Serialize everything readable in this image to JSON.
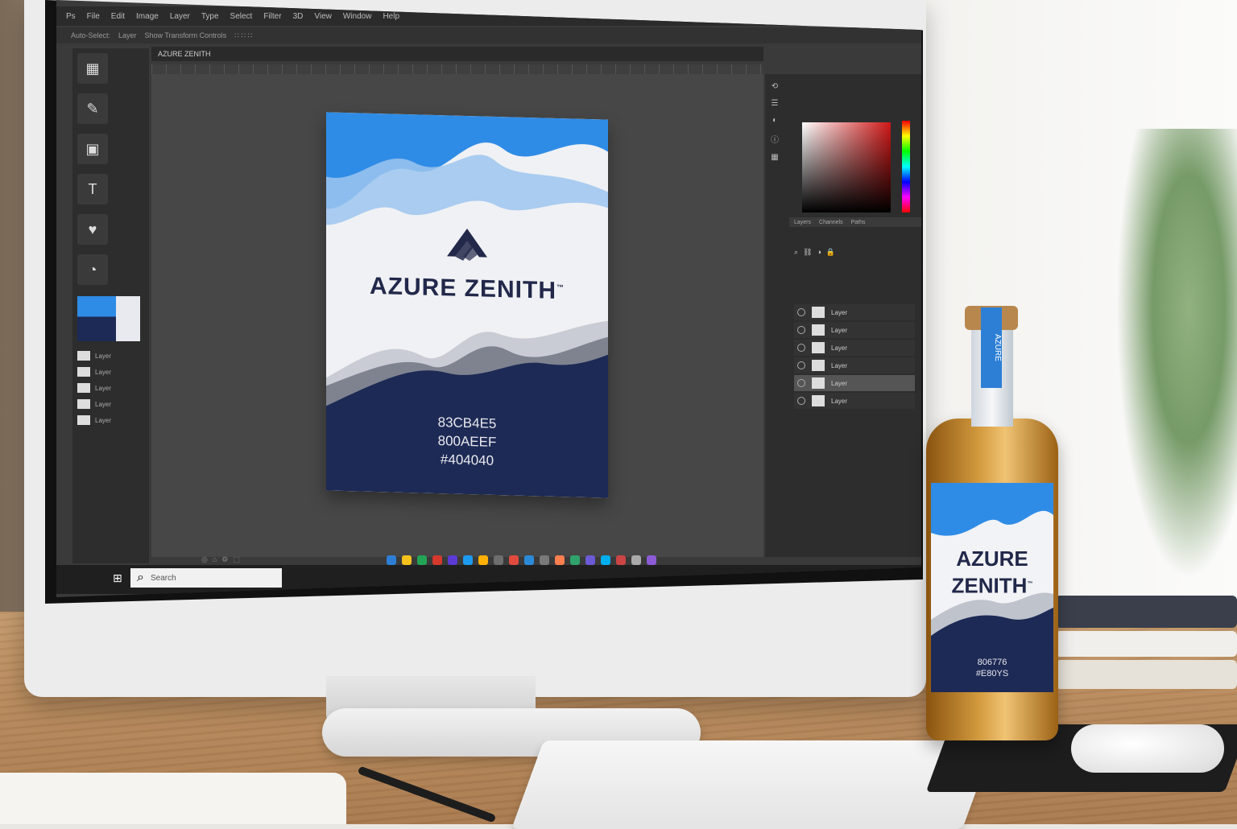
{
  "photoshop": {
    "menu": [
      "Ps",
      "File",
      "Edit",
      "Image",
      "Layer",
      "Type",
      "Select",
      "Filter",
      "3D",
      "View",
      "Window",
      "Help"
    ],
    "options": [
      "Auto-Select:",
      "Layer",
      "Show Transform Controls",
      "∷ ∷ ∷"
    ],
    "document_tab": "AZURE ZENITH",
    "left_tools": [
      {
        "icon": "image-icon",
        "label": ""
      },
      {
        "icon": "brush-icon",
        "label": ""
      },
      {
        "icon": "shape-icon",
        "label": ""
      },
      {
        "icon": "type-icon",
        "label": ""
      },
      {
        "icon": "heart-icon",
        "label": ""
      },
      {
        "icon": "circle-icon",
        "label": ""
      }
    ],
    "left_rows": [
      "Layer",
      "Layer",
      "Layer",
      "Layer",
      "Layer"
    ],
    "layers": [
      {
        "name": "Layer",
        "selected": false
      },
      {
        "name": "Layer",
        "selected": false
      },
      {
        "name": "Layer",
        "selected": false
      },
      {
        "name": "Layer",
        "selected": false
      },
      {
        "name": "Layer",
        "selected": true
      },
      {
        "name": "Layer",
        "selected": false
      }
    ],
    "status": [
      "◎",
      "⌂",
      "⚙",
      "⬚"
    ]
  },
  "poster": {
    "brand": "AZURE ZENITH",
    "tm": "™",
    "codes": [
      "83CB4E5",
      "800AEEF",
      "#404040"
    ]
  },
  "taskbar": {
    "search_placeholder": "Search",
    "apps": [
      "#2d7fd6",
      "#f4c21b",
      "#23a455",
      "#d5392b",
      "#5b3bd3",
      "#1d9bf0",
      "#ffb000",
      "#6e6e6e",
      "#e04b3e",
      "#2b8ad8",
      "#7a7a7a",
      "#ff7f50",
      "#2fa36b",
      "#6b5bd6",
      "#00aeef",
      "#c44",
      "#aaa",
      "#8d5bd6"
    ]
  },
  "bottle": {
    "neck_text": "AZURE",
    "brand_line1": "AZURE",
    "brand_line2": "ZENITH",
    "tm": "™",
    "codes": [
      "806776",
      "#E80YS"
    ]
  },
  "colors": {
    "azure": "#2f8ce6",
    "navy": "#1d2a55",
    "gray": "#404040"
  }
}
